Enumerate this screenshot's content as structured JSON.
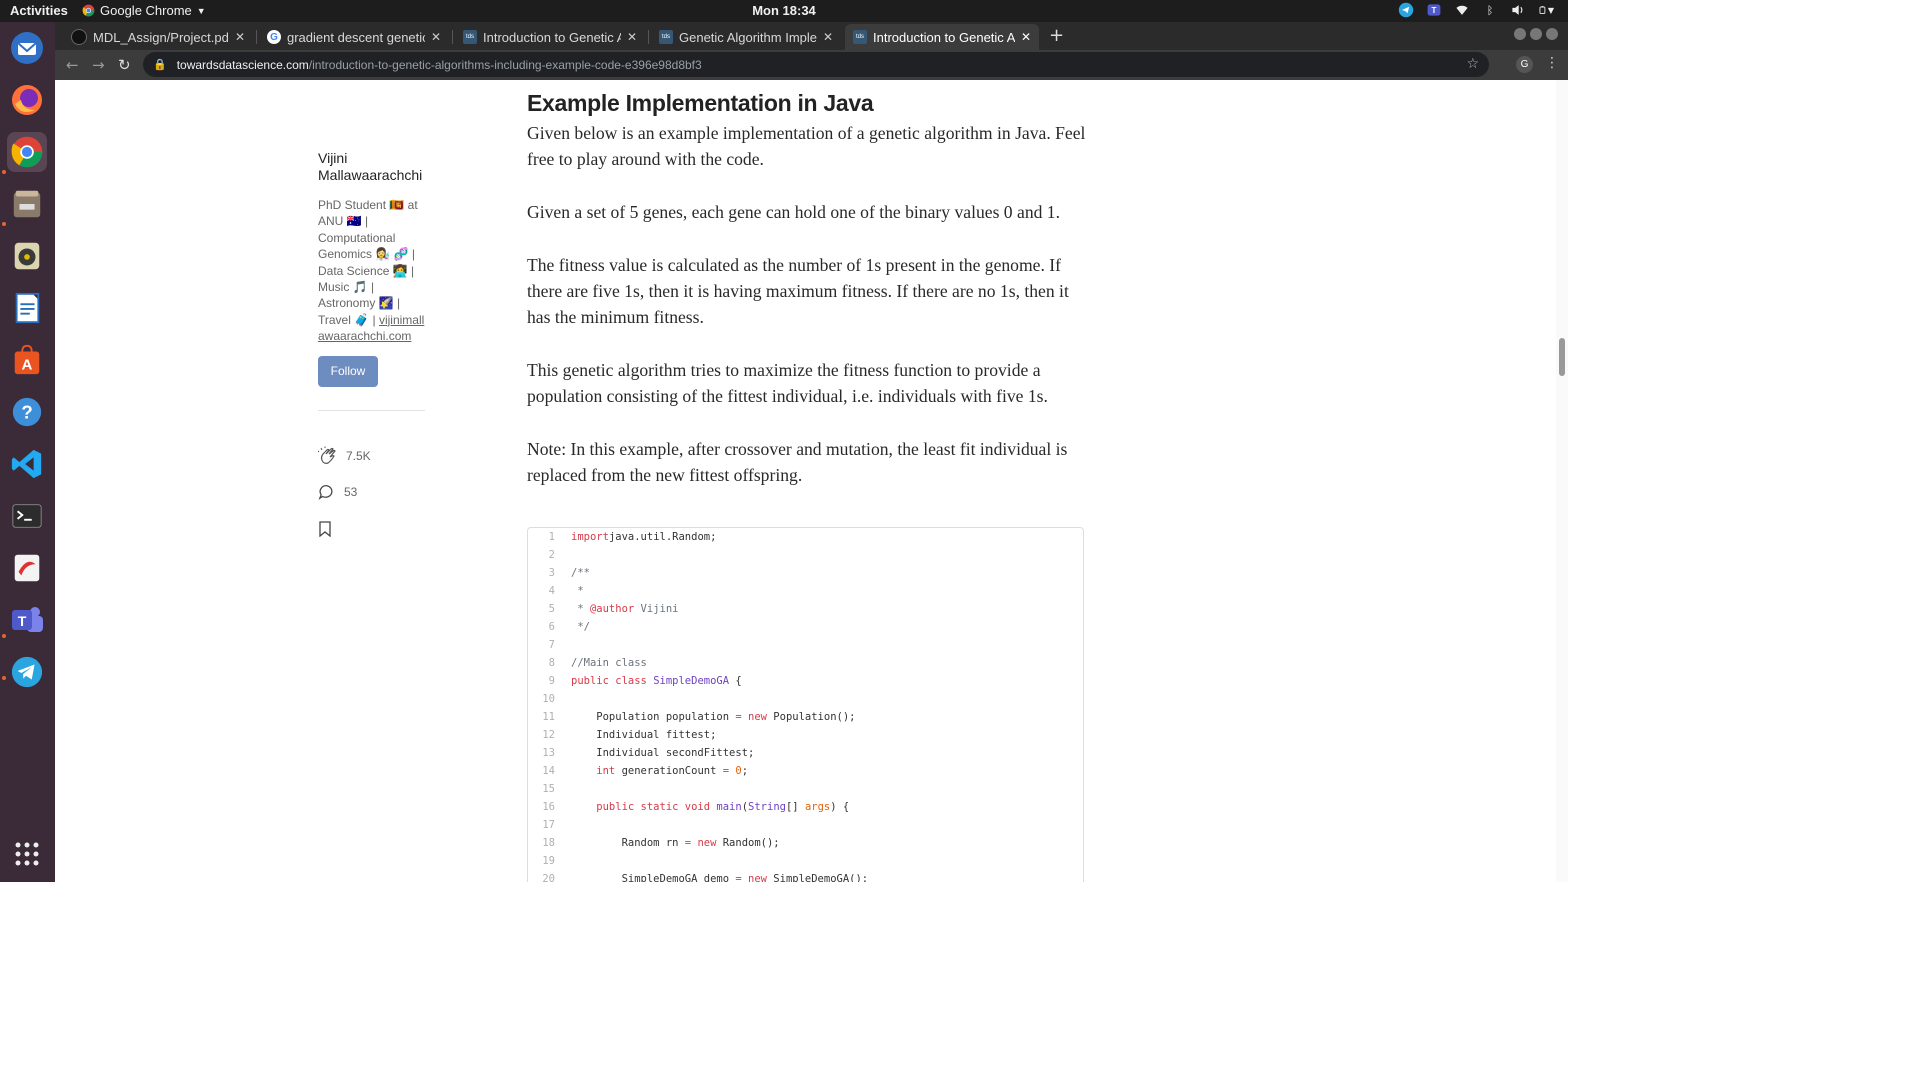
{
  "system": {
    "activities": "Activities",
    "app_name": "Google Chrome",
    "clock": "Mon 18:34"
  },
  "browser": {
    "tabs": [
      {
        "label": "MDL_Assign/Project.pdf"
      },
      {
        "label": "gradient descent genetic"
      },
      {
        "label": "Introduction to Genetic A"
      },
      {
        "label": "Genetic Algorithm Implem"
      },
      {
        "label": "Introduction to Genetic A",
        "active": true
      }
    ],
    "url_host": "towardsdatascience.com",
    "url_path": "/introduction-to-genetic-algorithms-including-example-code-e396e98d8bf3",
    "profile_initial": "G"
  },
  "author": {
    "name": "Vijini Mallawaarachchi",
    "bio": "PhD Student 🇱🇰 at ANU 🇦🇺 | Computational Genomics 👩‍🔬 🧬 | Data Science 👩‍💻 | Music 🎵 | Astronomy 🌠 | Travel 🧳 |",
    "website": "vijinimallawaarachchi.com",
    "follow_label": "Follow",
    "claps": "7.5K",
    "responses": "53"
  },
  "article": {
    "heading": "Example Implementation in Java",
    "paragraphs": [
      "Given below is an example implementation of a genetic algorithm in Java. Feel free to play around with the code.",
      "Given a set of 5 genes, each gene can hold one of the binary values 0 and 1.",
      "The fitness value is calculated as the number of 1s present in the genome. If there are five 1s, then it is having maximum fitness. If there are no 1s, then it has the minimum fitness.",
      "This genetic algorithm tries to maximize the fitness function to provide a population consisting of the fittest individual, i.e. individuals with five 1s.",
      "Note: In this example, after crossover and mutation, the least fit individual is replaced from the new fittest offspring."
    ]
  },
  "code": {
    "lines": [
      {
        "n": "1",
        "t": [
          [
            "kw",
            "import"
          ],
          [
            "",
            "java.util.Random;"
          ]
        ]
      },
      {
        "n": "2",
        "t": []
      },
      {
        "n": "3",
        "t": [
          [
            "cm",
            "/**"
          ]
        ]
      },
      {
        "n": "4",
        "t": [
          [
            "cm",
            " *"
          ]
        ]
      },
      {
        "n": "5",
        "t": [
          [
            "cm",
            " * "
          ],
          [
            "kw",
            "@author"
          ],
          [
            "cm",
            " Vijini"
          ]
        ]
      },
      {
        "n": "6",
        "t": [
          [
            "cm",
            " */"
          ]
        ]
      },
      {
        "n": "7",
        "t": []
      },
      {
        "n": "8",
        "t": [
          [
            "cm",
            "//Main class"
          ]
        ]
      },
      {
        "n": "9",
        "t": [
          [
            "kw",
            "public class "
          ],
          [
            "ty",
            "SimpleDemoGA"
          ],
          [
            "",
            " {"
          ]
        ]
      },
      {
        "n": "10",
        "t": []
      },
      {
        "n": "11",
        "t": [
          [
            "",
            "    Population population "
          ],
          [
            "kw",
            "= new"
          ],
          [
            "",
            " Population();"
          ]
        ]
      },
      {
        "n": "12",
        "t": [
          [
            "",
            "    Individual fittest;"
          ]
        ]
      },
      {
        "n": "13",
        "t": [
          [
            "",
            "    Individual secondFittest;"
          ]
        ]
      },
      {
        "n": "14",
        "t": [
          [
            "kw",
            "    int"
          ],
          [
            "",
            " generationCount "
          ],
          [
            "kw",
            "="
          ],
          [
            "",
            " "
          ],
          [
            "nu",
            "0"
          ],
          [
            "",
            ";"
          ]
        ]
      },
      {
        "n": "15",
        "t": []
      },
      {
        "n": "16",
        "t": [
          [
            "kw",
            "    public static void "
          ],
          [
            "ty",
            "main"
          ],
          [
            "",
            "("
          ],
          [
            "ty",
            "String"
          ],
          [
            "",
            "[] "
          ],
          [
            "nu",
            "args"
          ],
          [
            "",
            ") {"
          ]
        ]
      },
      {
        "n": "17",
        "t": []
      },
      {
        "n": "18",
        "t": [
          [
            "",
            "        Random rn "
          ],
          [
            "kw",
            "= new"
          ],
          [
            "",
            " Random();"
          ]
        ]
      },
      {
        "n": "19",
        "t": []
      },
      {
        "n": "20",
        "t": [
          [
            "",
            "        SimpleDemoGA demo "
          ],
          [
            "kw",
            "= new"
          ],
          [
            "",
            " SimpleDemoGA();"
          ]
        ]
      }
    ]
  }
}
